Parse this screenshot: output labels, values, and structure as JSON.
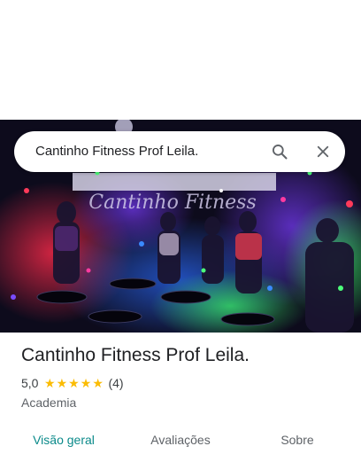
{
  "search": {
    "query": "Cantinho Fitness Prof Leila."
  },
  "place": {
    "name": "Cantinho Fitness Prof Leila.",
    "rating": "5,0",
    "stars": 5,
    "review_count": "(4)",
    "category": "Academia",
    "photo_sign_text": "Cantinho Fitness"
  },
  "tabs": [
    {
      "label": "Visão geral",
      "active": true
    },
    {
      "label": "Avaliações",
      "active": false
    },
    {
      "label": "Sobre",
      "active": false
    }
  ],
  "colors": {
    "active_tab": "#0b8a8a",
    "star": "#fbbc04",
    "text_primary": "#202124",
    "text_secondary": "#5f6368"
  },
  "icons": {
    "search": "search-icon",
    "close": "close-icon",
    "star": "star-icon"
  }
}
